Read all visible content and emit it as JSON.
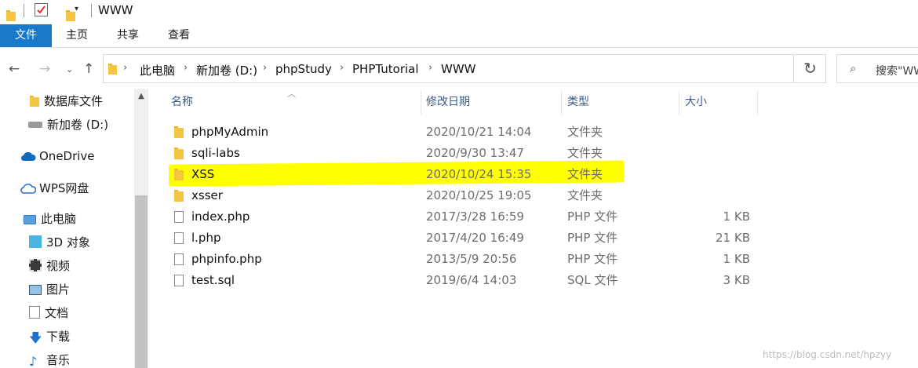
{
  "window": {
    "title": "WWW"
  },
  "ribbon": {
    "tabs": [
      "文件",
      "主页",
      "共享",
      "查看"
    ]
  },
  "address": {
    "crumbs": [
      "此电脑",
      "新加卷 (D:)",
      "phpStudy",
      "PHPTutorial",
      "WWW"
    ]
  },
  "search": {
    "placeholder": "搜索\"WWW\""
  },
  "nav": {
    "items": [
      "数据库文件",
      "新加卷 (D:)",
      "OneDrive",
      "WPS网盘",
      "此电脑",
      "3D 对象",
      "视频",
      "图片",
      "文档",
      "下载",
      "音乐"
    ]
  },
  "columns": {
    "name": "名称",
    "date": "修改日期",
    "type": "类型",
    "size": "大小"
  },
  "files": [
    {
      "name": "phpMyAdmin",
      "date": "2020/10/21 14:04",
      "type": "文件夹",
      "size": "",
      "icon": "folder-icon"
    },
    {
      "name": "sqli-labs",
      "date": "2020/9/30 13:47",
      "type": "文件夹",
      "size": "",
      "icon": "folder-icon"
    },
    {
      "name": "XSS",
      "date": "2020/10/24 15:35",
      "type": "文件夹",
      "size": "",
      "icon": "folder-icon"
    },
    {
      "name": "xsser",
      "date": "2020/10/25 19:05",
      "type": "文件夹",
      "size": "",
      "icon": "folder-icon"
    },
    {
      "name": "index.php",
      "date": "2017/3/28 16:59",
      "type": "PHP 文件",
      "size": "1 KB",
      "icon": "file-icon"
    },
    {
      "name": "l.php",
      "date": "2017/4/20 16:49",
      "type": "PHP 文件",
      "size": "21 KB",
      "icon": "file-icon"
    },
    {
      "name": "phpinfo.php",
      "date": "2013/5/9 20:56",
      "type": "PHP 文件",
      "size": "1 KB",
      "icon": "file-icon"
    },
    {
      "name": "test.sql",
      "date": "2019/6/4 14:03",
      "type": "SQL 文件",
      "size": "3 KB",
      "icon": "file-icon"
    }
  ],
  "watermark": "https://blog.csdn.net/hpzyy",
  "colors": {
    "accent": "#1979ca",
    "highlight": "#ffff00",
    "folder": "#f4c542"
  }
}
